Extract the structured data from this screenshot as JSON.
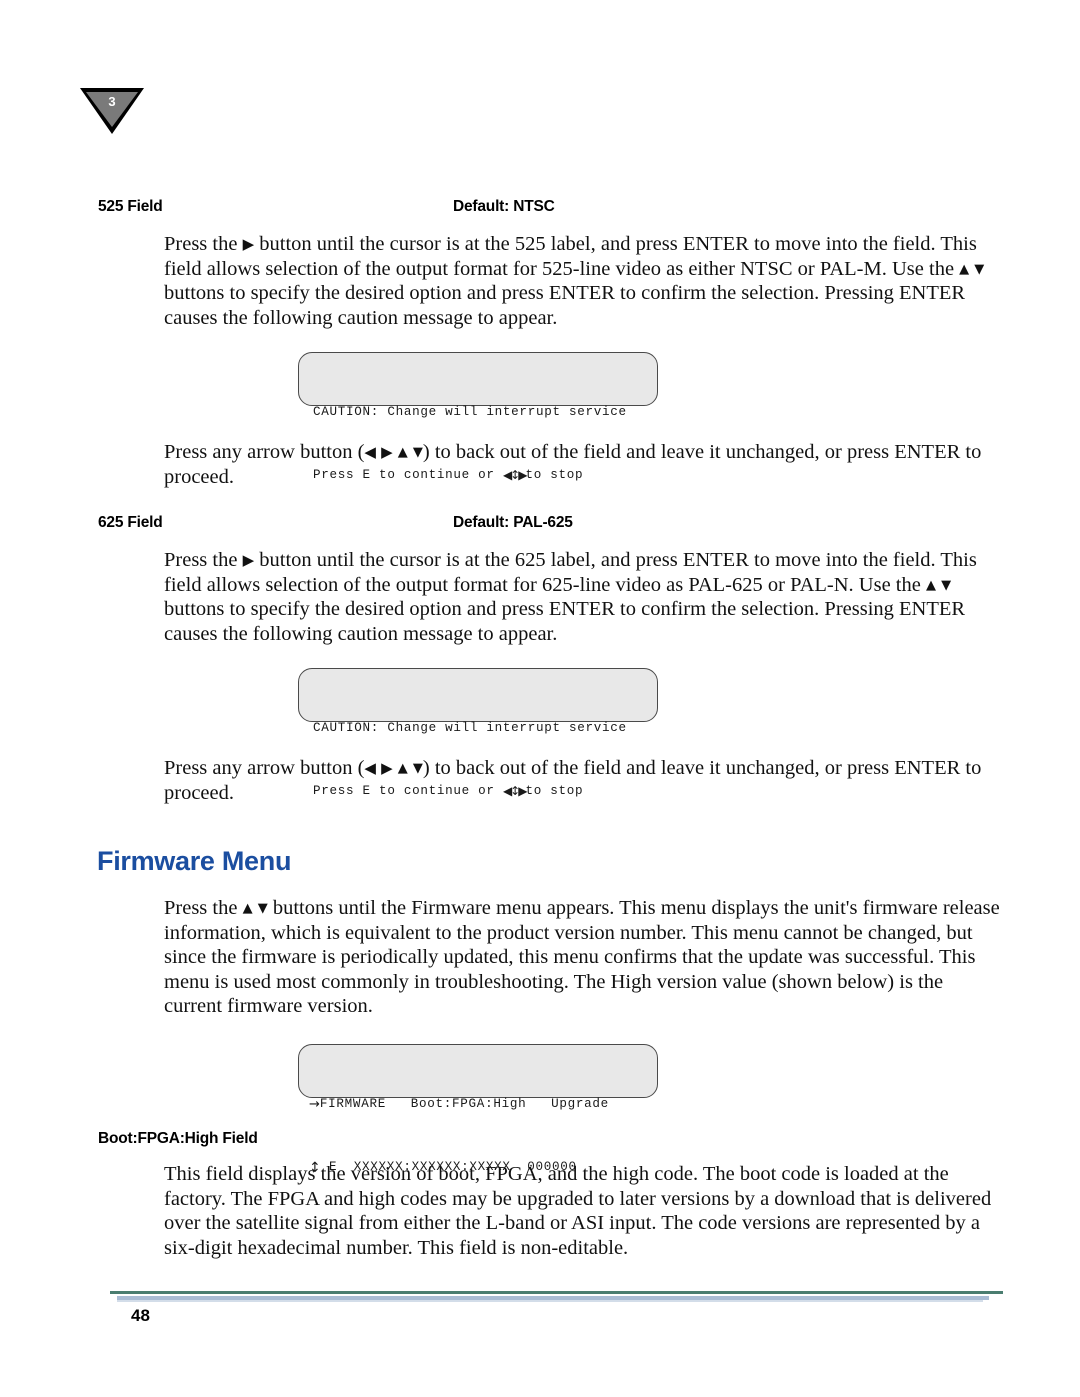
{
  "page": {
    "chapter_marker": "3",
    "page_number": "48"
  },
  "sections": [
    {
      "field_name": "525 Field",
      "default_label": "Default: NTSC",
      "paragraph_part1": "Press the ",
      "arrow_right": "▶",
      "paragraph_part2": " button until the cursor is at the 525 label, and press ENTER to move into the field. This field allows selection of the output format for 525-line video as either NTSC or PAL-M. Use the ",
      "arrow_up": "▲",
      "arrow_down": "▼",
      "paragraph_part3": " buttons to specify the desired option and press ENTER to confirm the selection. Pressing ENTER causes the following caution message to appear."
    },
    {
      "field_name": "625 Field",
      "default_label": "Default: PAL-625",
      "paragraph_part1": "Press the ",
      "arrow_right": "▶",
      "paragraph_part2": " button until the cursor is at the 625 label, and press ENTER to move into the field. This field allows selection of the output format for 625-line video as PAL-625 or PAL-N. Use the ",
      "arrow_up": "▲",
      "arrow_down": "▼",
      "paragraph_part3": " buttons to specify the desired option and press ENTER to confirm the selection. Pressing ENTER causes the following caution message to appear."
    }
  ],
  "caution_box": {
    "line1": "CAUTION: Change will interrupt service",
    "line2_prefix": "Press E to continue or ",
    "line2_glyph": "◀↕▶",
    "line2_suffix": "to stop"
  },
  "arrow_note": {
    "prefix": "Press any arrow button (",
    "arrow_left": "◀",
    "arrow_right": "▶",
    "arrow_up": "▲",
    "arrow_down": "▼",
    "suffix": ") to back out of the field and leave it unchanged, or press ENTER to proceed."
  },
  "firmware_section": {
    "heading": "Firmware Menu",
    "paragraph_prefix": "Press the ",
    "arrow_up": "▲",
    "arrow_down": "▼",
    "paragraph_suffix": " buttons until the Firmware menu appears. This menu displays the unit's firmware release information, which is equivalent to the product version number. This menu cannot be changed, but since the firmware is periodically updated, this menu confirms that the update was successful. This menu is used most commonly in troubleshooting. The High version value (shown below) is the current firmware version.",
    "lcd": {
      "row1_arrow": "→",
      "row1_label": "FIRMWARE",
      "row1_col2": "Boot:FPGA:High",
      "row1_col3": "Upgrade",
      "row2_arrow": "↕",
      "row2_label": "E",
      "row2_col2": "XXXXXX:XXXXXX:XXXXX",
      "row2_col3": "000000"
    },
    "subfield_name": "Boot:FPGA:High Field",
    "subfield_paragraph": "This field displays the version of boot, FPGA, and the high code. The boot code is loaded at the factory. The FPGA and high codes may be upgraded to later versions by a download that is delivered over the satellite signal from either the L-band or ASI input. The code versions are represented by a six-digit hexadecimal number. This field is non-editable."
  },
  "colors": {
    "heading_blue": "#1b4ea0",
    "lcd_fill": "#e8e8e8",
    "rule_dark": "#4a7d70",
    "rule_light": "#a9bcd4"
  }
}
